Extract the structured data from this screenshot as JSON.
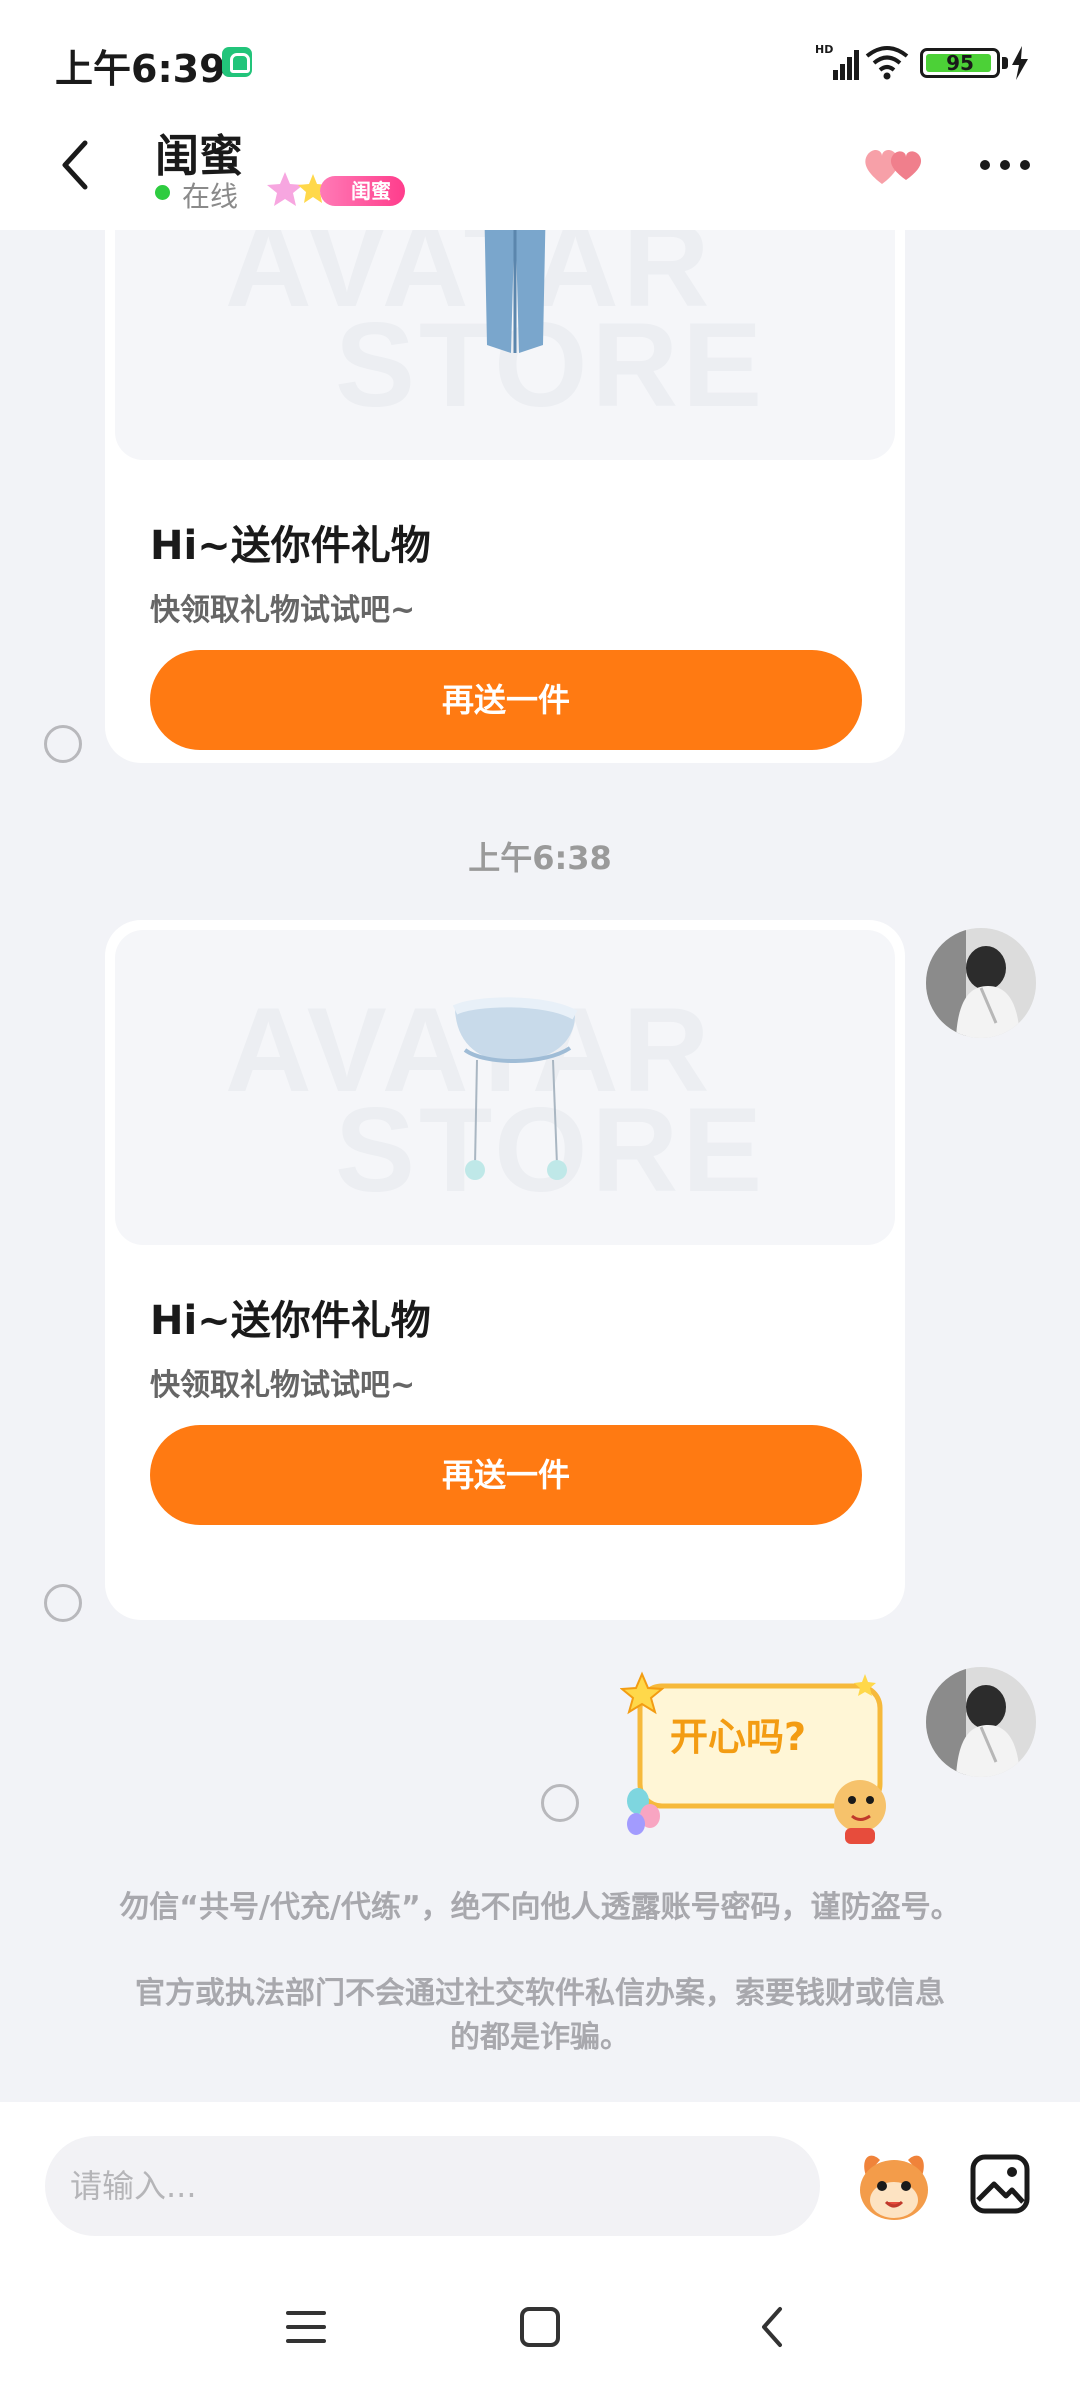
{
  "status_bar": {
    "time": "上午6:39",
    "network": "HD",
    "battery": "95"
  },
  "header": {
    "title": "闺蜜",
    "online_status": "在线",
    "relation_badge": "闺蜜"
  },
  "messages": [
    {
      "type": "gift",
      "title": "Hi~送你件礼物",
      "subtitle": "快领取礼物试试吧~",
      "button": "再送一件",
      "watermark": [
        "AVATAR",
        "STORE"
      ]
    },
    {
      "type": "time",
      "text": "上午6:38"
    },
    {
      "type": "gift",
      "title": "Hi~送你件礼物",
      "subtitle": "快领取礼物试试吧~",
      "button": "再送一件",
      "watermark": [
        "AVATAR",
        "STORE"
      ]
    },
    {
      "type": "sticker",
      "text": "开心吗?"
    }
  ],
  "notices": [
    "勿信“共号/代充/代练”，绝不向他人透露账号密码，谨防盗号。",
    "官方或执法部门不会通过社交软件私信办案，索要钱财或信息",
    "的都是诈骗。"
  ],
  "input": {
    "placeholder": "请输入..."
  },
  "colors": {
    "accent": "#ff7a12",
    "online": "#2ecc40",
    "badge": "#ff3d8c",
    "background": "#f2f3f7"
  }
}
